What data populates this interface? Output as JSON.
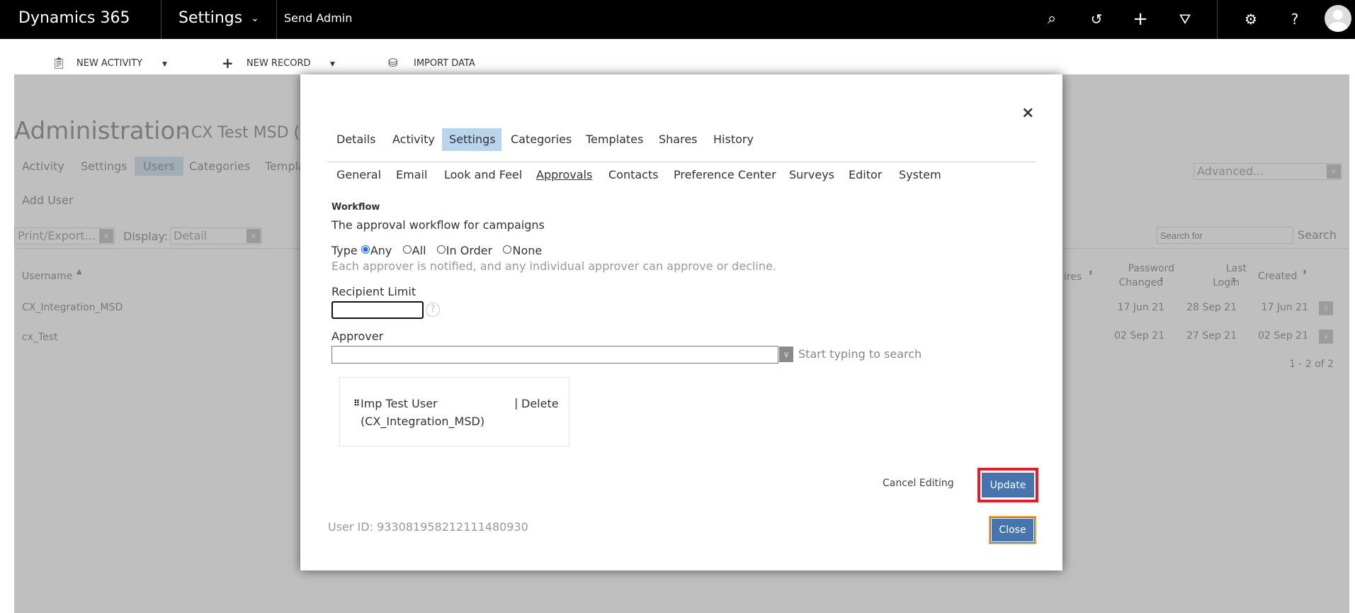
{
  "topbar": {
    "app": "Dynamics 365",
    "area": "Settings",
    "entity": "Send Admin",
    "icons": [
      "search-icon",
      "history-icon",
      "plus-icon",
      "filter-icon",
      "gear-icon",
      "help-icon",
      "avatar"
    ]
  },
  "toolbar": {
    "new_activity": "NEW ACTIVITY",
    "new_record": "NEW RECORD",
    "import_data": "IMPORT DATA"
  },
  "background": {
    "title": "Administration",
    "subtitle": "- CX Test MSD (Clie",
    "tabs": [
      "Activity",
      "Settings",
      "Users",
      "Categories",
      "Templa"
    ],
    "active_tab": "Users",
    "add_user": "Add User",
    "print_export": "Print/Export...",
    "display_label": "Display:",
    "display_value": "Detail",
    "advanced": "Advanced...",
    "search_placeholder": "Search for",
    "search_label": "Search",
    "columns": {
      "username": "Username",
      "expires": "ires",
      "password_changed_1": "Password",
      "password_changed_2": "Changed",
      "last_login_1": "Last",
      "last_login_2": "Login",
      "created": "Created"
    },
    "rows": [
      {
        "username": "CX_Integration_MSD",
        "password_changed": "17 Jun 21",
        "last_login": "28 Sep 21",
        "created": "17 Jun 21"
      },
      {
        "username": "cx_Test",
        "password_changed": "02 Sep 21",
        "last_login": "27 Sep 21",
        "created": "02 Sep 21"
      }
    ],
    "pagination": "1 - 2 of 2"
  },
  "modal": {
    "close_x": "×",
    "tabs": [
      "Details",
      "Activity",
      "Settings",
      "Categories",
      "Templates",
      "Shares",
      "History"
    ],
    "active_tab": "Settings",
    "subtabs": [
      "General",
      "Email",
      "Look and Feel",
      "Approvals",
      "Contacts",
      "Preference Center",
      "Surveys",
      "Editor",
      "System"
    ],
    "active_subtab": "Approvals",
    "workflow_heading": "Workflow",
    "workflow_desc": "The approval workflow for campaigns",
    "type_label": "Type",
    "type_options": [
      "Any",
      "All",
      "In Order",
      "None"
    ],
    "type_selected": "Any",
    "type_help": "Each approver is notified, and any individual approver can approve or decline.",
    "recipient_limit_label": "Recipient Limit",
    "recipient_limit_value": "",
    "help_glyph": "?",
    "approver_label": "Approver",
    "approver_value": "",
    "approver_hint": "Start typing to search",
    "approver_card": {
      "name": "Imp Test User",
      "username": "(CX_Integration_MSD)",
      "delete": "Delete"
    },
    "cancel_editing": "Cancel Editing",
    "update": "Update",
    "user_id": "User ID: 933081958212111480930",
    "close": "Close"
  },
  "colors": {
    "primary_button": "#4674ad",
    "highlight": "#e8192c",
    "close_focus": "#f0a030",
    "selected_tab": "#b9d5ee"
  }
}
